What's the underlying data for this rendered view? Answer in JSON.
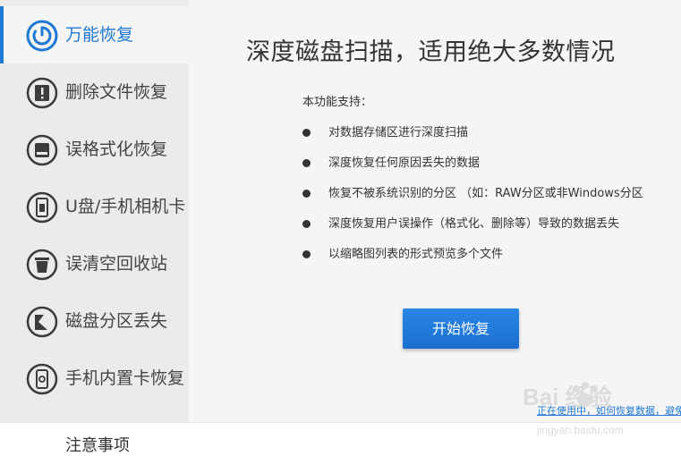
{
  "sidebar": {
    "items": [
      {
        "label": "万能恢复",
        "icon": "power-restore-icon",
        "active": true
      },
      {
        "label": "删除文件恢复",
        "icon": "file-alert-icon",
        "active": false
      },
      {
        "label": "误格式化恢复",
        "icon": "hard-drive-icon",
        "active": false
      },
      {
        "label": "U盘/手机相机卡",
        "icon": "usb-drive-icon",
        "active": false
      },
      {
        "label": "误清空回收站",
        "icon": "trash-icon",
        "active": false
      },
      {
        "label": "磁盘分区丢失",
        "icon": "partition-icon",
        "active": false
      },
      {
        "label": "手机内置卡恢复",
        "icon": "phone-icon",
        "active": false
      }
    ]
  },
  "main": {
    "title": "深度磁盘扫描，适用绝大多数情况",
    "intro": "本功能支持：",
    "features": [
      "对数据存储区进行深度扫描",
      "深度恢复任何原因丢失的数据",
      "恢复不被系统识别的分区 （如：RAW分区或非Windows分区",
      "深度恢复用户误操作（格式化、删除等）导致的数据丢失",
      "以缩略图列表的形式预览多个文件"
    ],
    "start_button": "开始恢复",
    "footer_link": "正在使用中，如何恢复数据，避免"
  },
  "watermark": {
    "text": "Bai 经验",
    "url_text": "jingyan.baidu.com"
  },
  "note": "注意事项",
  "colors": {
    "accent": "#1e78d4",
    "sidebar_bg": "#ebebeb",
    "panel_bg": "#f5f5f5",
    "icon_dark": "#3c3c3c"
  }
}
